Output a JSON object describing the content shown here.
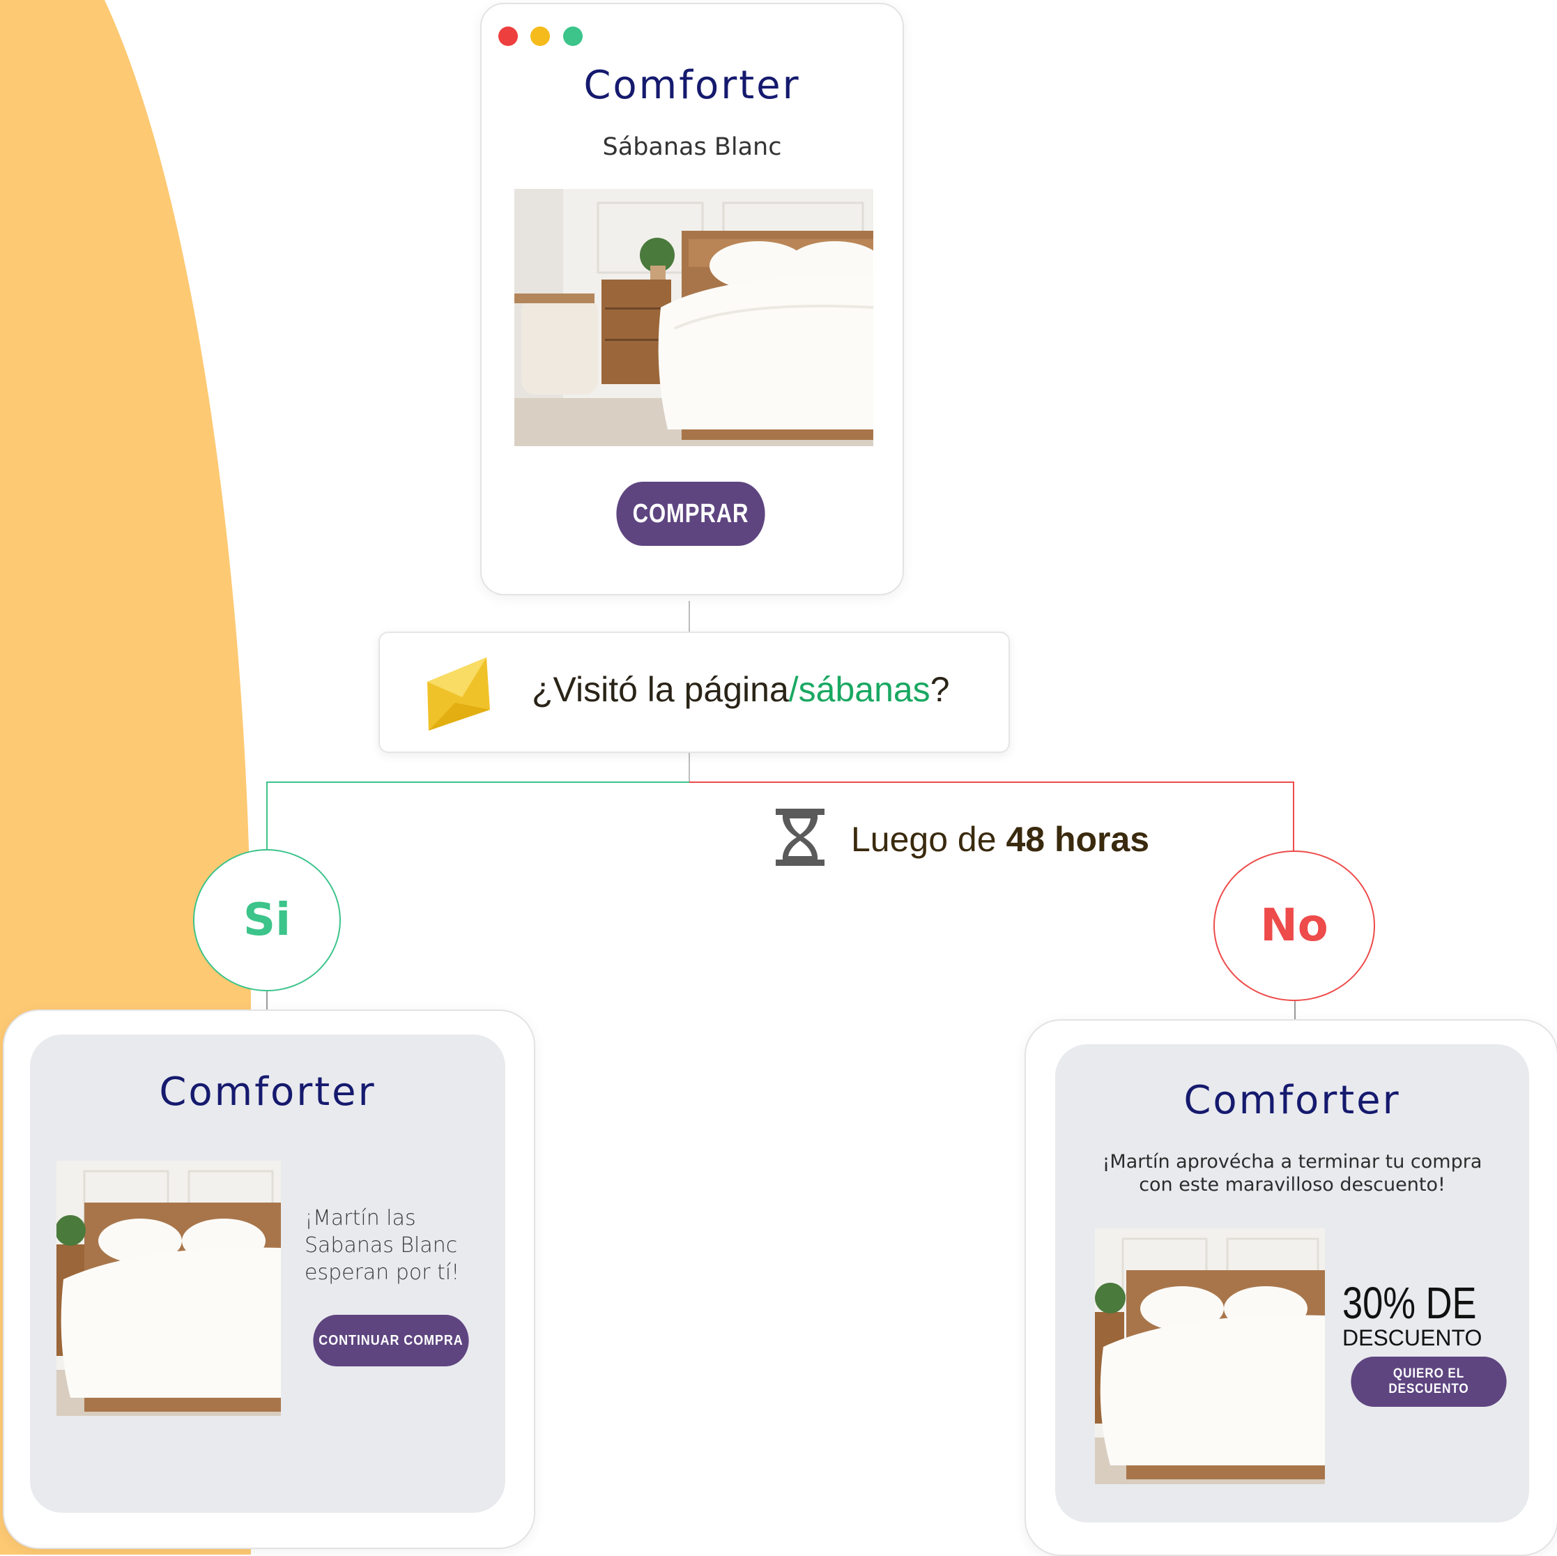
{
  "colors": {
    "brand_navy": "#151a6e",
    "button_purple": "#5e4580",
    "yes_green": "#3cc48a",
    "no_red": "#ee4b4b",
    "accent_green": "#1aa862",
    "bg_orange": "#fdc973"
  },
  "top_card": {
    "brand": "Comforter",
    "product_title": "Sábanas Blanc",
    "button_label": "COMPRAR",
    "window_dots": [
      "#ee3f3f",
      "#f5bb1c",
      "#3cc48a"
    ]
  },
  "question": {
    "icon": "envelope-icon",
    "text_prefix": "¿Visitó la página",
    "text_highlight": "/sábanas",
    "text_suffix": "?"
  },
  "delay": {
    "icon": "hourglass-icon",
    "prefix": "Luego de ",
    "bold": "48 horas"
  },
  "branch_yes": {
    "label": "Si"
  },
  "branch_no": {
    "label": "No"
  },
  "yes_card": {
    "brand": "Comforter",
    "message_line1": "¡Martín las",
    "message_line2": "Sabanas Blanc",
    "message_line3": "esperan por tí!",
    "button_label": "CONTINUAR COMPRA"
  },
  "no_card": {
    "brand": "Comforter",
    "message_line1": "¡Martín aprovécha a terminar tu compra",
    "message_line2": "con este maravilloso descuento!",
    "discount_big": "30% DE",
    "discount_small": "DESCUENTO",
    "button_label": "QUIERO EL DESCUENTO"
  }
}
